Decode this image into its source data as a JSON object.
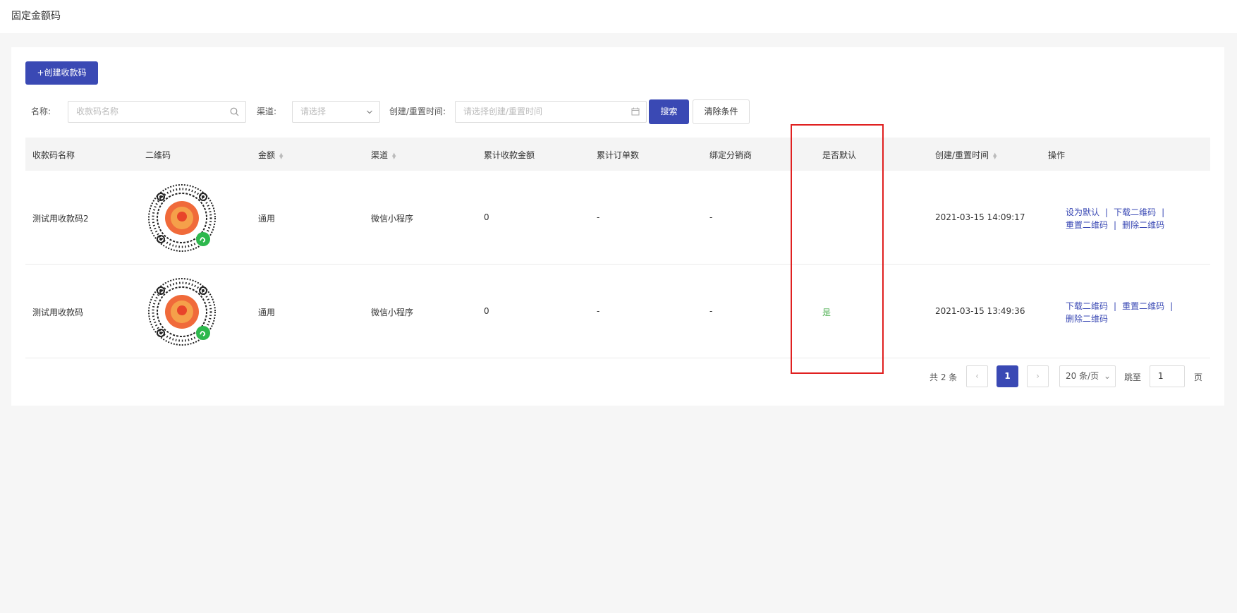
{
  "page": {
    "title": "固定金额码"
  },
  "toolbar": {
    "create_label": "+创建收款码"
  },
  "filters": {
    "name_label": "名称:",
    "name_placeholder": "收款码名称",
    "channel_label": "渠道:",
    "channel_placeholder": "请选择",
    "time_label": "创建/重置时间:",
    "time_placeholder": "请选择创建/重置时间",
    "search_label": "搜索",
    "clear_label": "清除条件"
  },
  "table": {
    "columns": [
      "收款码名称",
      "二维码",
      "金额",
      "渠道",
      "累计收款金额",
      "累计订单数",
      "绑定分销商",
      "是否默认",
      "创建/重置时间",
      "操作"
    ],
    "rows": [
      {
        "name": "测试用收款码2",
        "amount": "通用",
        "channel": "微信小程序",
        "total_amount": "0",
        "order_count": "-",
        "distributor": "-",
        "is_default": "",
        "time": "2021-03-15 14:09:17",
        "ops": [
          "设为默认",
          "下载二维码",
          "重置二维码",
          "删除二维码"
        ]
      },
      {
        "name": "测试用收款码",
        "amount": "通用",
        "channel": "微信小程序",
        "total_amount": "0",
        "order_count": "-",
        "distributor": "-",
        "is_default": "是",
        "time": "2021-03-15 13:49:36",
        "ops": [
          "下载二维码",
          "重置二维码",
          "删除二维码"
        ]
      }
    ]
  },
  "pagination": {
    "total_label": "共 2 条",
    "current_page": "1",
    "page_size": "20 条/页",
    "jump_label": "跳至",
    "jump_value": "1",
    "page_suffix": "页"
  },
  "colors": {
    "primary": "#3a49b4",
    "default_yes": "#4caf50",
    "highlight": "#e02020"
  },
  "icons": [
    "search-icon",
    "chevron-down-icon",
    "calendar-icon",
    "sort-icon",
    "qr-code-image",
    "mini-program-badge-icon",
    "chevron-left-icon",
    "chevron-right-icon"
  ]
}
